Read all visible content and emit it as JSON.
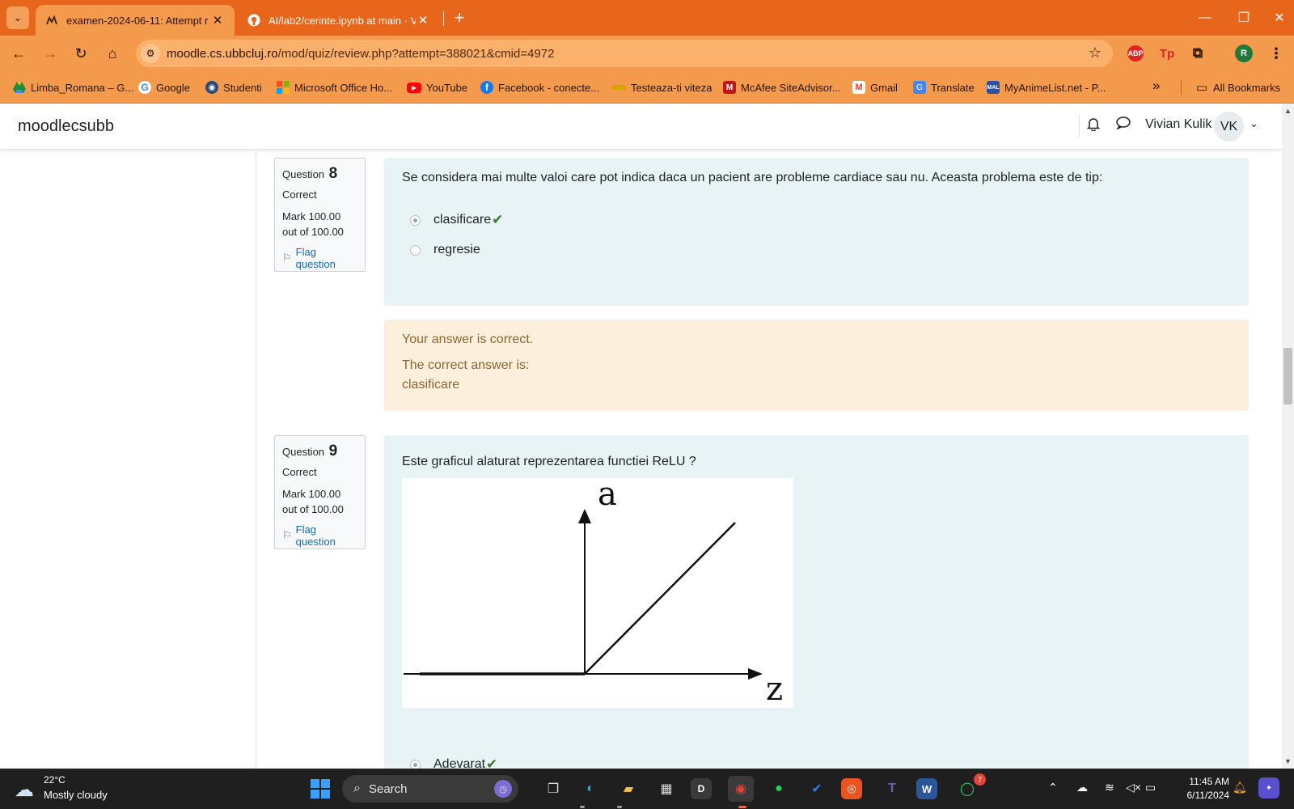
{
  "browser": {
    "tabs": [
      {
        "title": "examen-2024-06-11: Attempt r",
        "active": true,
        "favicon": "moodle-favicon-icon"
      },
      {
        "title": "AI/lab2/cerinte.ipynb at main · V",
        "active": false,
        "favicon": "github-icon"
      }
    ],
    "address_domain": "moodle.cs.ubbcluj.ro",
    "address_path": "/mod/quiz/review.php?attempt=388021&cmid=4972",
    "extensions": {
      "abp": "ABP",
      "tp": "Tp",
      "profile_initial": "R"
    },
    "bookmarks": [
      {
        "label": "Limba_Romana – G...",
        "icon": "google-drive-icon"
      },
      {
        "label": "Google",
        "icon": "google-icon"
      },
      {
        "label": "Studenti",
        "icon": "studenti-icon"
      },
      {
        "label": "Microsoft Office Ho...",
        "icon": "microsoft-office-icon"
      },
      {
        "label": "YouTube",
        "icon": "youtube-icon"
      },
      {
        "label": "Facebook - conecte...",
        "icon": "facebook-icon"
      },
      {
        "label": "Testeaza-ti viteza",
        "icon": "speedtest-icon"
      },
      {
        "label": "McAfee SiteAdvisor...",
        "icon": "mcafee-icon"
      },
      {
        "label": "Gmail",
        "icon": "gmail-icon"
      },
      {
        "label": "Translate",
        "icon": "google-translate-icon"
      },
      {
        "label": "MyAnimeList.net - P...",
        "icon": "myanimelist-icon"
      }
    ],
    "all_bookmarks_label": "All Bookmarks",
    "colors": {
      "chrome_dark": "#e8651c",
      "chrome_light": "#f49a4c"
    }
  },
  "moodle": {
    "brand": "moodlecsubb",
    "user_name": "Vivian Kulik",
    "user_initials": "VK"
  },
  "questions": [
    {
      "label": "Question",
      "number": "8",
      "state": "Correct",
      "mark": "Mark 100.00 out of 100.00",
      "flag_label": "Flag question",
      "text": "Se considera mai multe valoi care pot indica daca un pacient are probleme cardiace sau nu. Aceasta problema este de tip:",
      "options": [
        {
          "label": "clasificare",
          "selected": true,
          "correct": true
        },
        {
          "label": "regresie",
          "selected": false,
          "correct": false
        }
      ],
      "feedback": {
        "result": "Your answer is correct.",
        "correct_answer_heading": "The correct answer is:",
        "correct_answer": "clasificare"
      }
    },
    {
      "label": "Question",
      "number": "9",
      "state": "Correct",
      "mark": "Mark 100.00 out of 100.00",
      "flag_label": "Flag question",
      "text": "Este graficul alaturat reprezentarea functiei ReLU ?",
      "figure": {
        "y_axis_label": "a",
        "x_axis_label": "z"
      },
      "options": [
        {
          "label": "Adevarat",
          "selected": true,
          "correct": true
        }
      ]
    }
  ],
  "taskbar": {
    "temperature": "22°C",
    "weather": "Mostly cloudy",
    "search_label": "Search",
    "time": "11:45 AM",
    "date": "6/11/2024",
    "whatsapp_badge": "7"
  },
  "colors": {
    "formulation_bg": "#e7f3f5",
    "feedback_bg": "#fcefdc",
    "correct_green": "#357a32",
    "link_blue": "#0f6cbf"
  }
}
